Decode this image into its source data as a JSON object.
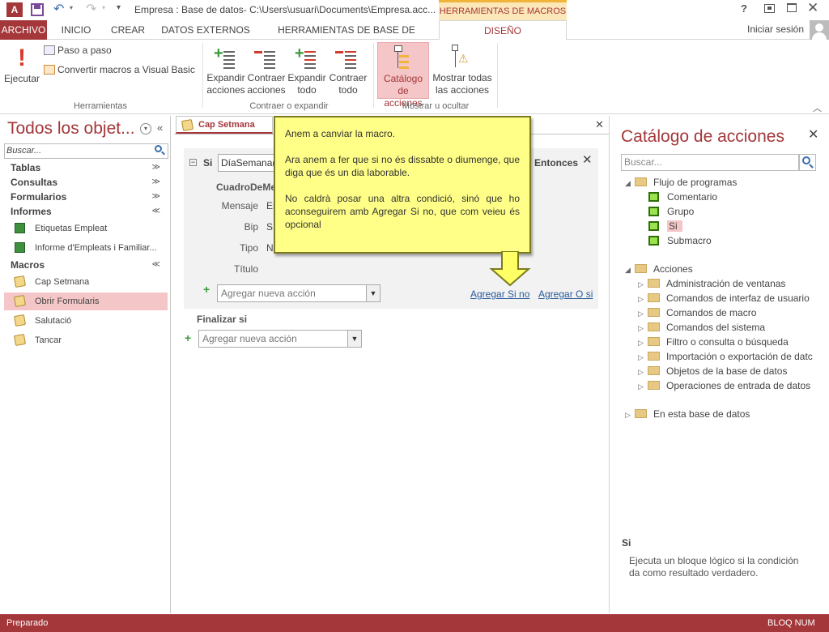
{
  "title_bar": {
    "window_title": "Empresa : Base de datos- C:\\Users\\usuari\\Documents\\Empresa.acc...",
    "contextual_tab": "HERRAMIENTAS DE MACROS",
    "help": "?",
    "app_icon_text": "A"
  },
  "tabs": [
    "ARCHIVO",
    "INICIO",
    "CREAR",
    "DATOS EXTERNOS",
    "HERRAMIENTAS DE BASE DE DATOS",
    "DISEÑO"
  ],
  "signin": "Iniciar sesión",
  "ribbon": {
    "ejecutar": "Ejecutar",
    "paso": "Paso a paso",
    "convertir": "Convertir macros a Visual Basic",
    "group_herramientas": "Herramientas",
    "expandir_acciones": [
      "Expandir",
      "acciones"
    ],
    "contraer_acciones": [
      "Contraer",
      "acciones"
    ],
    "expandir_todo": [
      "Expandir",
      "todo"
    ],
    "contraer_todo": [
      "Contraer",
      "todo"
    ],
    "group_contraer": "Contraer o expandir",
    "catalogo": [
      "Catálogo",
      "de acciones"
    ],
    "mostrar": [
      "Mostrar todas",
      "las acciones"
    ],
    "group_mostrar": "Mostrar u ocultar"
  },
  "nav": {
    "title": "Todos los objet...",
    "search_placeholder": "Buscar...",
    "tablas": "Tablas",
    "consultas": "Consultas",
    "formularios": "Formularios",
    "informes": "Informes",
    "informe_items": [
      "Etiquetas Empleat",
      "Informe d'Empleats i Familiar..."
    ],
    "macros": "Macros",
    "macro_items": [
      "Cap Setmana",
      "Obrir Formularis",
      "Salutació",
      "Tancar"
    ]
  },
  "doc": {
    "tab_title": "Cap Setmana",
    "si_label": "Si",
    "condition": "DíaSemana(",
    "entonces": "Entonces",
    "action_name": "CuadroDeMe",
    "fields": [
      {
        "label": "Mensaje",
        "value": "Es"
      },
      {
        "label": "Bip",
        "value": "Sí"
      },
      {
        "label": "Tipo",
        "value": "N"
      },
      {
        "label": "Título",
        "value": ""
      }
    ],
    "add_action": "Agregar nueva acción",
    "agregar_si_no": "Agregar Si no",
    "agregar_o_si": "Agregar O si",
    "finalizar_si": "Finalizar si",
    "add_action2": "Agregar nueva acción"
  },
  "callout": {
    "p1": "Anem a canviar la macro.",
    "p2": "Ara anem a fer que si no és dissabte o diumenge, que diga que és un dia laborable.",
    "p3": "No caldrà posar una altra condició, sinó que ho aconseguirem amb Agregar Si no, que com veieu és opcional"
  },
  "catalog": {
    "title": "Catálogo de acciones",
    "search_placeholder": "Buscar...",
    "flujo": "Flujo de programas",
    "flujo_items": [
      "Comentario",
      "Grupo",
      "Si",
      "Submacro"
    ],
    "acciones": "Acciones",
    "acciones_items": [
      "Administración de ventanas",
      "Comandos de interfaz de usuario",
      "Comandos de macro",
      "Comandos del sistema",
      "Filtro o consulta o búsqueda",
      "Importación o exportación de datc",
      "Objetos de la base de datos",
      "Operaciones de entrada de datos"
    ],
    "esta_base": "En esta base de datos",
    "help_title": "Si",
    "help_text": "Ejecuta un bloque lógico si la condición da como resultado verdadero."
  },
  "status": {
    "left": "Preparado",
    "right": "BLOQ NUM"
  },
  "colors": {
    "accent": "#a4373a",
    "selected_nav": "#f4c6c7",
    "callout_bg": "#ffff88"
  }
}
